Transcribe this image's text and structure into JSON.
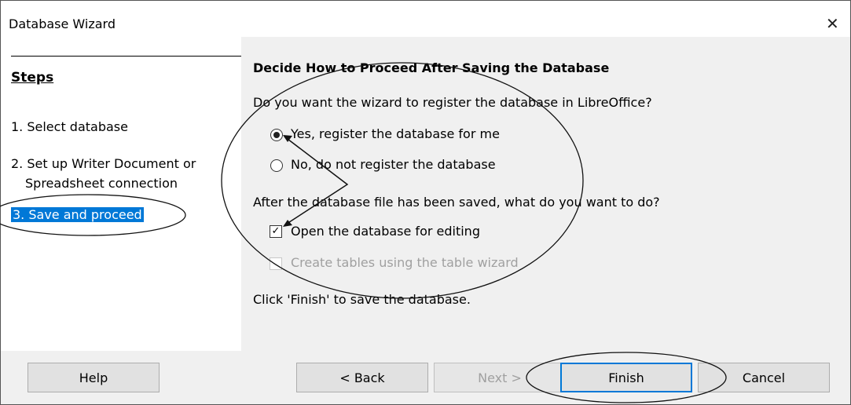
{
  "window": {
    "title": "Database Wizard",
    "close_glyph": "✕"
  },
  "steps": {
    "title": "Steps",
    "items": [
      {
        "label": "1. Select database"
      },
      {
        "label": "2. Set up Writer Document or"
      },
      {
        "label": "Spreadsheet connection"
      },
      {
        "label": "3. Save and proceed"
      }
    ]
  },
  "main": {
    "heading": "Decide How to Proceed After Saving the Database",
    "register_question": "Do you want the wizard to register the database in LibreOffice?",
    "radio_yes": {
      "label": "Yes, register the database for me",
      "selected": true
    },
    "radio_no": {
      "label": "No, do not register the database",
      "selected": false
    },
    "after_question": "After the database file has been saved, what do you want to do?",
    "check_open": {
      "label": "Open the database for editing",
      "checked": true
    },
    "check_tables": {
      "label": "Create tables using the table wizard",
      "checked": false,
      "enabled": false
    },
    "finish_hint": "Click 'Finish' to save the database."
  },
  "buttons": {
    "help": "Help",
    "back": "< Back",
    "next": "Next >",
    "finish": "Finish",
    "cancel": "Cancel"
  },
  "colors": {
    "selection": "#0078d7",
    "dialog_bg": "#f0f0f0",
    "disabled_text": "#a0a0a0"
  }
}
